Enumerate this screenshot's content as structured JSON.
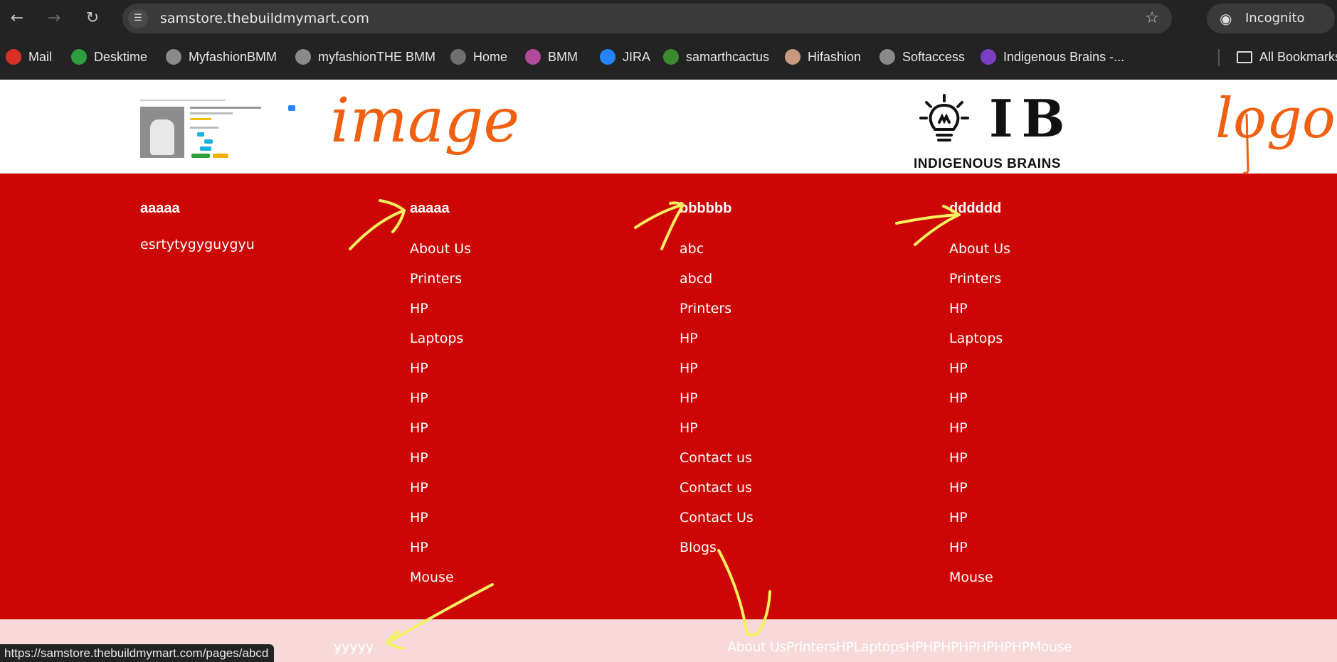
{
  "browser": {
    "url": "samstore.thebuildmymart.com",
    "profile_label": "Incognito",
    "icons": {
      "back": "arrow-left-icon",
      "forward": "arrow-right-icon",
      "reload": "reload-icon",
      "site_info": "tune-icon",
      "bookmark": "star-icon",
      "incognito": "incognito-icon"
    },
    "bookmarks": [
      {
        "label": "Mail",
        "icon": "gmail-icon",
        "color": "#d93025"
      },
      {
        "label": "Desktime",
        "icon": "desktime-icon",
        "color": "#2e9e3e"
      },
      {
        "label": "MyfashionBMM",
        "icon": "globe-icon",
        "color": "#8a8a8a"
      },
      {
        "label": "myfashionTHE BMM",
        "icon": "globe-icon",
        "color": "#8a8a8a"
      },
      {
        "label": "Home",
        "icon": "globe-icon",
        "color": "#6f6f6f"
      },
      {
        "label": "BMM",
        "icon": "bmm-icon",
        "color": "#b24a9b"
      },
      {
        "label": "JIRA",
        "icon": "jira-icon",
        "color": "#2684ff"
      },
      {
        "label": "samarthcactus",
        "icon": "cactus-icon",
        "color": "#3c8b2f"
      },
      {
        "label": "Hifashion",
        "icon": "hifashion-icon",
        "color": "#c79a7d"
      },
      {
        "label": "Softaccess",
        "icon": "globe-icon",
        "color": "#8a8a8a"
      },
      {
        "label": "Indigenous Brains -...",
        "icon": "indigenous-brains-icon",
        "color": "#7c3fc4"
      }
    ],
    "all_bookmarks_label": "All Bookmarks",
    "status_url": "https://samstore.thebuildmymart.com/pages/abcd"
  },
  "header": {
    "annotation_image": "image",
    "annotation_logo": "logo",
    "logo": {
      "letters": "IB",
      "tagline": "INDIGENOUS BRAINS"
    }
  },
  "footer": {
    "columns": [
      {
        "title": "aaaaa",
        "description": "esrtytygyguygyu",
        "links": []
      },
      {
        "title": "aaaaa",
        "links": [
          "About Us",
          "Printers",
          "HP",
          "Laptops",
          "HP",
          "HP",
          "HP",
          "HP",
          "HP",
          "HP",
          "HP",
          "Mouse"
        ]
      },
      {
        "title": "bbbbbb",
        "links": [
          "abc",
          "abcd",
          "Printers",
          "HP",
          "HP",
          "HP",
          "HP",
          "Contact us",
          "Contact us",
          "Contact Us",
          "Blogs"
        ]
      },
      {
        "title": "dddddd",
        "links": [
          "About Us",
          "Printers",
          "HP",
          "Laptops",
          "HP",
          "HP",
          "HP",
          "HP",
          "HP",
          "HP",
          "HP",
          "Mouse"
        ]
      }
    ],
    "bottom": {
      "copyright": "yyyyy",
      "links": [
        "About Us",
        "Printers",
        "HP",
        "Laptops",
        "HP",
        "HP",
        "HP",
        "HP",
        "HP",
        "HP",
        "HP",
        "Mouse"
      ]
    }
  },
  "colors": {
    "footer_bg": "#cc0505",
    "bottom_bar_bg": "#f7d9d9",
    "annotation_orange": "#f06010",
    "annotation_yellow": "#f5f060"
  }
}
